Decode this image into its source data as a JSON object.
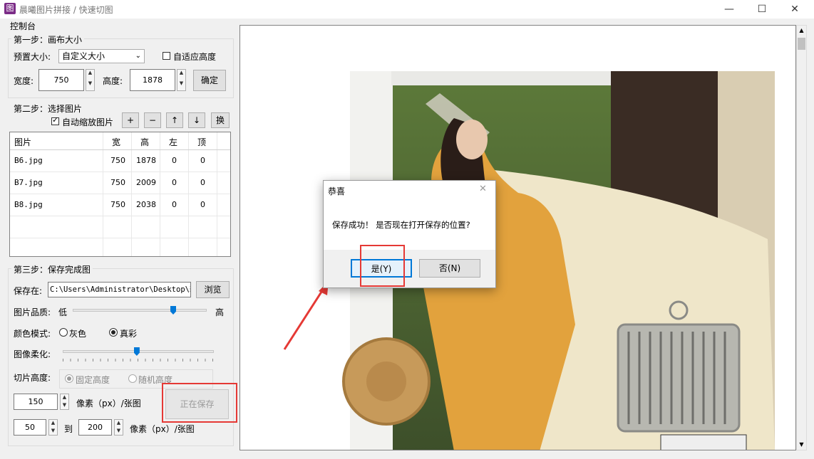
{
  "window": {
    "icon_glyph": "图",
    "title": "晨曦图片拼接 / 快速切图",
    "minimize_glyph": "—",
    "maximize_glyph": "☐",
    "close_glyph": "✕"
  },
  "panel": {
    "title": "控制台",
    "step1": {
      "title": "第一步：画布大小",
      "preset_label": "预置大小:",
      "preset_value": "自定义大小",
      "fit_height_label": "自适应高度",
      "width_label": "宽度:",
      "width_value": "750",
      "height_label": "高度:",
      "height_value": "1878",
      "confirm_label": "确定"
    },
    "step2": {
      "title": "第二步：选择图片",
      "auto_scale_label": "自动缩放图片",
      "buttons": [
        "+",
        "−",
        "↑",
        "↓",
        "换"
      ],
      "columns": [
        "图片",
        "宽",
        "高",
        "左",
        "顶"
      ],
      "rows": [
        [
          "B6.jpg",
          "750",
          "1878",
          "0",
          "0"
        ],
        [
          "B7.jpg",
          "750",
          "2009",
          "0",
          "0"
        ],
        [
          "B8.jpg",
          "750",
          "2038",
          "0",
          "0"
        ]
      ]
    },
    "step3": {
      "title": "第三步：保存完成图",
      "save_to_label": "保存在:",
      "save_path": "C:\\Users\\Administrator\\Desktop\\新",
      "browse_label": "浏览",
      "quality_label": "图片品质:",
      "quality_low": "低",
      "quality_high": "高",
      "quality_value": 0.75,
      "color_mode_label": "颜色模式:",
      "gray_label": "灰色",
      "truecolor_label": "真彩",
      "soften_label": "图像柔化:",
      "soften_value": 0.49,
      "slice_height_label": "切片高度:",
      "fixed_height_label": "固定高度",
      "random_height_label": "随机高度",
      "fixed_value": "150",
      "unit_label": "像素（px）/张图",
      "range_from": "50",
      "range_to_label": "到",
      "range_to": "200",
      "unit_label2": "像素（px）/张图",
      "saving_label": "正在保存"
    }
  },
  "dialog": {
    "title": "恭喜",
    "message": "保存成功！ 是否现在打开保存的位置?",
    "yes_label": "是(Y)",
    "no_label": "否(N)",
    "close_glyph": "✕"
  },
  "colors": {
    "accent": "#0078d7",
    "highlight": "#e53935"
  }
}
